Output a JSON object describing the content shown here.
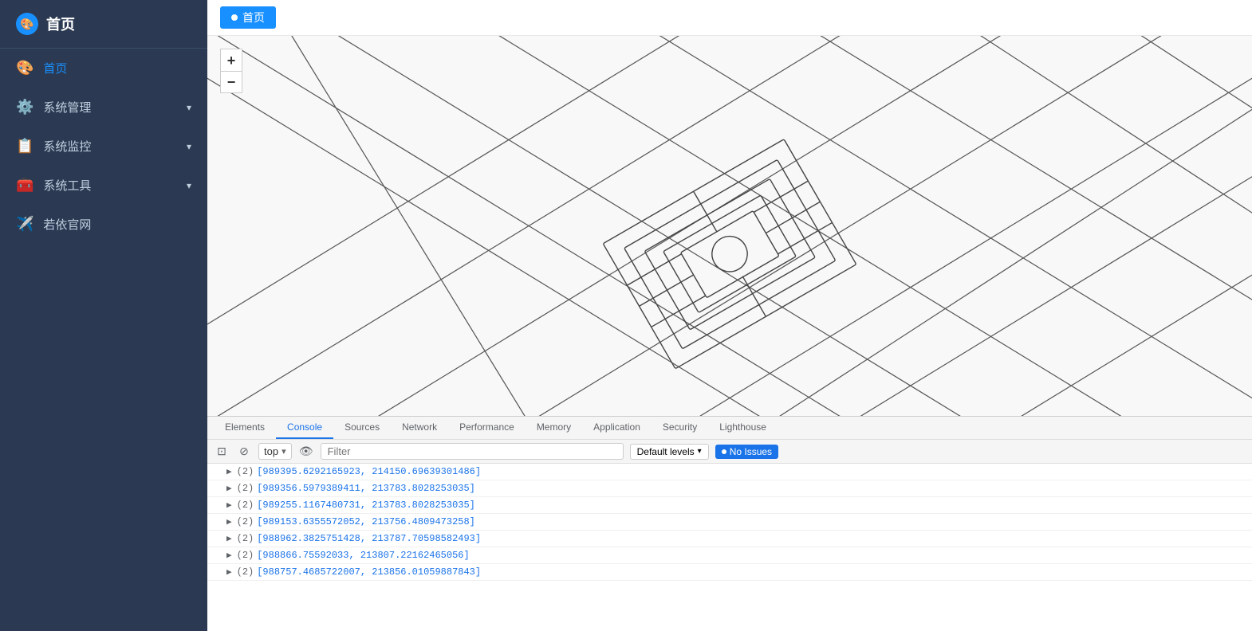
{
  "sidebar": {
    "logo": {
      "icon": "🎨",
      "text": "首页"
    },
    "items": [
      {
        "id": "home",
        "icon": "🎨",
        "label": "首页",
        "active": true,
        "hasChevron": false
      },
      {
        "id": "sys-mgmt",
        "icon": "⚙️",
        "label": "系统管理",
        "active": false,
        "hasChevron": true
      },
      {
        "id": "sys-monitor",
        "icon": "📋",
        "label": "系统监控",
        "active": false,
        "hasChevron": true
      },
      {
        "id": "sys-tools",
        "icon": "🧰",
        "label": "系统工具",
        "active": false,
        "hasChevron": true
      },
      {
        "id": "ruoyi-site",
        "icon": "✈️",
        "label": "若依官网",
        "active": false,
        "hasChevron": false
      }
    ]
  },
  "breadcrumb": {
    "tab_label": "首页"
  },
  "map_controls": {
    "zoom_in": "+",
    "zoom_out": "−"
  },
  "devtools": {
    "tabs": [
      {
        "id": "elements",
        "label": "Elements",
        "active": false
      },
      {
        "id": "console",
        "label": "Console",
        "active": true
      },
      {
        "id": "sources",
        "label": "Sources",
        "active": false
      },
      {
        "id": "network",
        "label": "Network",
        "active": false
      },
      {
        "id": "performance",
        "label": "Performance",
        "active": false
      },
      {
        "id": "memory",
        "label": "Memory",
        "active": false
      },
      {
        "id": "application",
        "label": "Application",
        "active": false
      },
      {
        "id": "security",
        "label": "Security",
        "active": false
      },
      {
        "id": "lighthouse",
        "label": "Lighthouse",
        "active": false
      }
    ],
    "toolbar": {
      "context_selector": "top",
      "filter_placeholder": "Filter",
      "levels_label": "Default levels",
      "no_issues_label": "No Issues"
    },
    "console_lines": [
      {
        "count": "(2)",
        "text": "[989395.6292165923, 214150.69639301486]"
      },
      {
        "count": "(2)",
        "text": "[989356.5979389411, 213783.8028253035]"
      },
      {
        "count": "(2)",
        "text": "[989255.1167480731, 213783.8028253035]"
      },
      {
        "count": "(2)",
        "text": "[989153.6355572052, 213756.4809473258]"
      },
      {
        "count": "(2)",
        "text": "[988962.3825751428, 213787.70598582493]"
      },
      {
        "count": "(2)",
        "text": "[988866.75592033, 213807.22162465056]"
      },
      {
        "count": "(2)",
        "text": "[988757.4685722007, 213856.01059887843]"
      }
    ]
  }
}
